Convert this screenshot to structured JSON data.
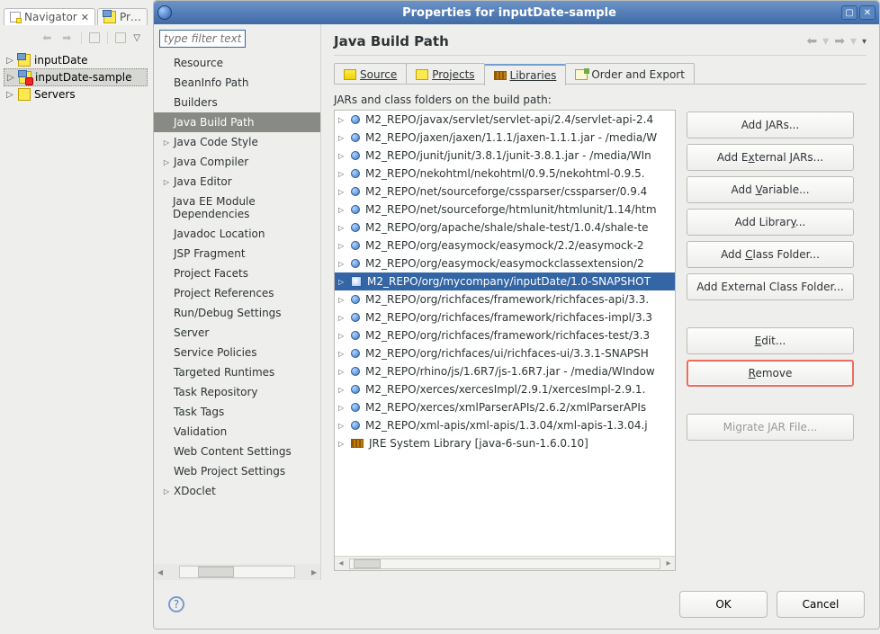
{
  "backTabs": {
    "navigator": "Navigator",
    "prTruncated": "Pr…"
  },
  "navTree": {
    "items": [
      {
        "label": "inputDate",
        "selected": false,
        "badge": false
      },
      {
        "label": "inputDate-sample",
        "selected": true,
        "badge": true
      },
      {
        "label": "Servers",
        "selected": false,
        "badge": false,
        "serv": true
      }
    ]
  },
  "dialog": {
    "title": "Properties for inputDate-sample",
    "okLabel": "OK",
    "cancelLabel": "Cancel"
  },
  "filterPlaceholder": "type filter text",
  "categories": [
    {
      "label": "Resource"
    },
    {
      "label": "BeanInfo Path"
    },
    {
      "label": "Builders"
    },
    {
      "label": "Java Build Path",
      "selected": true
    },
    {
      "label": "Java Code Style",
      "expandable": true
    },
    {
      "label": "Java Compiler",
      "expandable": true
    },
    {
      "label": "Java Editor",
      "expandable": true
    },
    {
      "label": "Java EE Module Dependencies"
    },
    {
      "label": "Javadoc Location"
    },
    {
      "label": "JSP Fragment"
    },
    {
      "label": "Project Facets"
    },
    {
      "label": "Project References"
    },
    {
      "label": "Run/Debug Settings"
    },
    {
      "label": "Server"
    },
    {
      "label": "Service Policies"
    },
    {
      "label": "Targeted Runtimes"
    },
    {
      "label": "Task Repository"
    },
    {
      "label": "Task Tags"
    },
    {
      "label": "Validation"
    },
    {
      "label": "Web Content Settings"
    },
    {
      "label": "Web Project Settings"
    },
    {
      "label": "XDoclet",
      "expandable": true
    }
  ],
  "page": {
    "title": "Java Build Path",
    "tabs": {
      "source": "Source",
      "projects": "Projects",
      "libraries": "Libraries",
      "order": "Order and Export"
    },
    "subLabel": "JARs and class folders on the build path:",
    "jars": [
      "M2_REPO/javax/servlet/servlet-api/2.4/servlet-api-2.4",
      "M2_REPO/jaxen/jaxen/1.1.1/jaxen-1.1.1.jar - /media/W",
      "M2_REPO/junit/junit/3.8.1/junit-3.8.1.jar - /media/WIn",
      "M2_REPO/nekohtml/nekohtml/0.9.5/nekohtml-0.9.5.",
      "M2_REPO/net/sourceforge/cssparser/cssparser/0.9.4",
      "M2_REPO/net/sourceforge/htmlunit/htmlunit/1.14/htm",
      "M2_REPO/org/apache/shale/shale-test/1.0.4/shale-te",
      "M2_REPO/org/easymock/easymock/2.2/easymock-2",
      "M2_REPO/org/easymock/easymockclassextension/2",
      "M2_REPO/org/mycompany/inputDate/1.0-SNAPSHOT",
      "M2_REPO/org/richfaces/framework/richfaces-api/3.3.",
      "M2_REPO/org/richfaces/framework/richfaces-impl/3.3",
      "M2_REPO/org/richfaces/framework/richfaces-test/3.3",
      "M2_REPO/org/richfaces/ui/richfaces-ui/3.3.1-SNAPSH",
      "M2_REPO/rhino/js/1.6R7/js-1.6R7.jar - /media/WIndow",
      "M2_REPO/xerces/xercesImpl/2.9.1/xercesImpl-2.9.1.",
      "M2_REPO/xerces/xmlParserAPIs/2.6.2/xmlParserAPIs",
      "M2_REPO/xml-apis/xml-apis/1.3.04/xml-apis-1.3.04.j"
    ],
    "selectedJarIndex": 9,
    "jreLabel": "JRE System Library [java-6-sun-1.6.0.10]",
    "buttons": {
      "addJars": "Add JARs...",
      "addExternal": "Add External JARs...",
      "addVariable": "Add Variable...",
      "addLibrary": "Add Library...",
      "addClass": "Add Class Folder...",
      "addExtClass": "Add External Class Folder...",
      "edit": "Edit...",
      "remove": "Remove",
      "migrate": "Migrate JAR File..."
    }
  }
}
